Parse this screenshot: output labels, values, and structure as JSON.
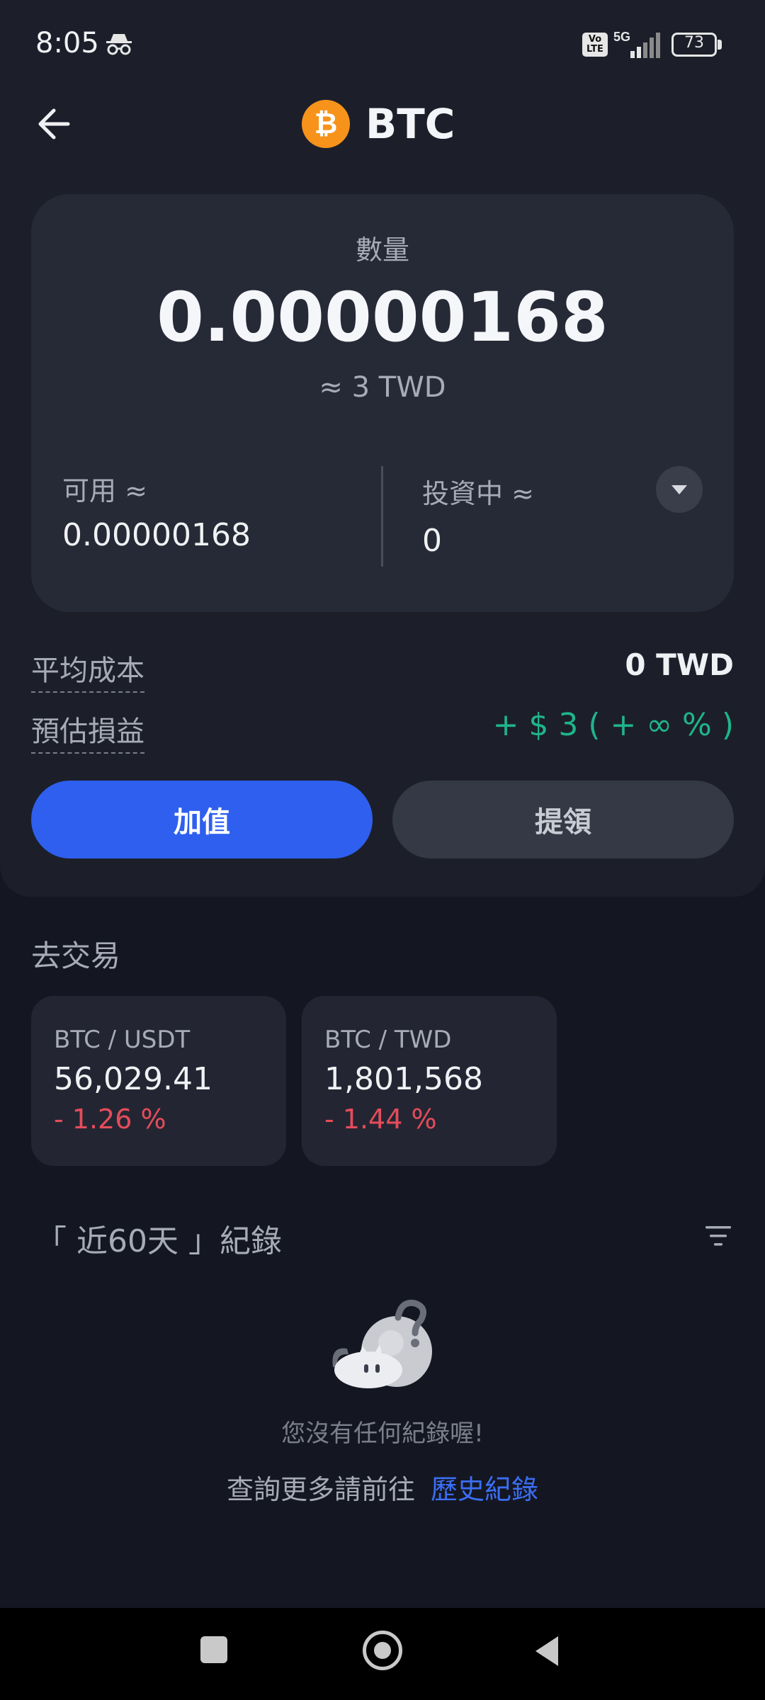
{
  "status_bar": {
    "time": "8:05",
    "network": "5G",
    "volte": "Vo LTE",
    "battery": "73"
  },
  "header": {
    "coin_icon_symbol": "₿",
    "title": "BTC"
  },
  "balance": {
    "quantity_label": "數量",
    "quantity_value": "0.00000168",
    "fiat_value": "≈ 3 TWD",
    "available_label": "可用 ≈",
    "available_value": "0.00000168",
    "investing_label": "投資中 ≈",
    "investing_value": "0"
  },
  "stats": {
    "avg_cost_label": "平均成本",
    "avg_cost_value": "0 TWD",
    "pnl_label": "預估損益",
    "pnl_value": "+ $ 3 ( + ∞ % )"
  },
  "actions": {
    "deposit_label": "加值",
    "withdraw_label": "提領"
  },
  "trade": {
    "title": "去交易",
    "pairs": [
      {
        "name": "BTC / USDT",
        "price": "56,029.41",
        "change": "- 1.26 %"
      },
      {
        "name": "BTC / TWD",
        "price": "1,801,568",
        "change": "- 1.44 %"
      }
    ]
  },
  "records": {
    "title": "「 近60天 」紀錄",
    "empty_text": "您沒有任何紀錄喔!",
    "history_prefix": "查詢更多請前往",
    "history_link": "歷史紀錄"
  },
  "colors": {
    "accent": "#2e5fef",
    "positive": "#1fb58b",
    "negative": "#e54c5b",
    "btc_orange": "#f7931a"
  },
  "icons": {
    "back": "arrow-left-icon",
    "expand": "chevron-down-icon",
    "filter": "filter-icon",
    "incognito": "incognito-icon"
  }
}
